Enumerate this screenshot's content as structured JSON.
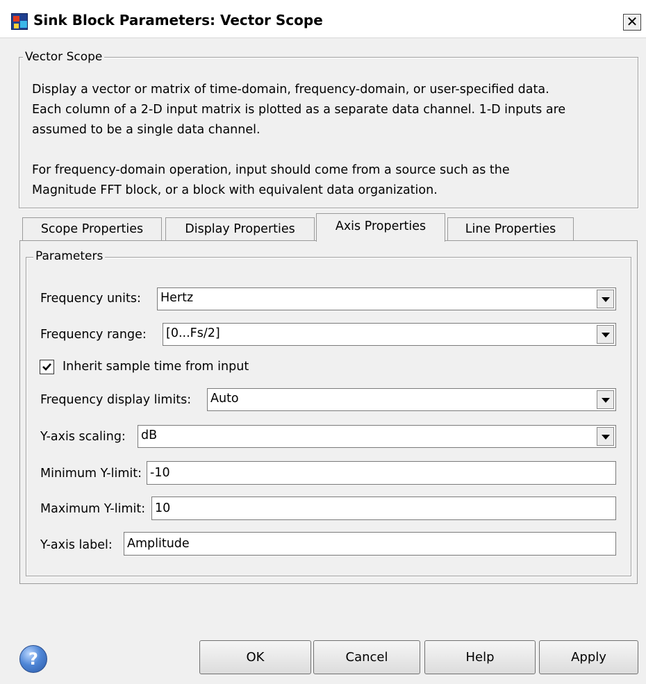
{
  "window": {
    "title": "Sink Block Parameters: Vector Scope",
    "close_glyph": "✕"
  },
  "description_group": {
    "legend": "Vector Scope",
    "lines": [
      "Display a vector or matrix of time-domain, frequency-domain, or user-specified data.",
      "Each column of a 2-D input matrix is plotted as a separate data channel.  1-D inputs are",
      "assumed to be a single data channel.",
      "",
      "For frequency-domain operation, input should come from a source such as the",
      "Magnitude FFT block, or a block with equivalent data organization."
    ]
  },
  "tabs": [
    {
      "label": "Scope Properties",
      "active": false
    },
    {
      "label": "Display Properties",
      "active": false
    },
    {
      "label": "Axis Properties",
      "active": true
    },
    {
      "label": "Line Properties",
      "active": false
    }
  ],
  "parameters": {
    "legend": "Parameters",
    "frequency_units": {
      "label": "Frequency units:",
      "value": "Hertz"
    },
    "frequency_range": {
      "label": "Frequency range:",
      "value": "[0...Fs/2]"
    },
    "inherit_sample_time": {
      "label": "Inherit sample time from input",
      "checked": true
    },
    "frequency_display_limits": {
      "label": "Frequency display limits:",
      "value": "Auto"
    },
    "y_axis_scaling": {
      "label": "Y-axis scaling:",
      "value": "dB"
    },
    "minimum_y_limit": {
      "label": "Minimum Y-limit:",
      "value": "-10"
    },
    "maximum_y_limit": {
      "label": "Maximum Y-limit:",
      "value": "10"
    },
    "y_axis_label": {
      "label": "Y-axis label:",
      "value": "Amplitude"
    }
  },
  "buttons": {
    "help_icon_glyph": "?",
    "ok": "OK",
    "cancel": "Cancel",
    "help": "Help",
    "apply": "Apply"
  },
  "icons": {
    "app": "simulink-block-icon",
    "help": "help-question-icon",
    "close": "close-icon",
    "dropdown": "chevron-down-icon"
  },
  "colors": {
    "dialog_background": "#f0f0f0",
    "titlebar_background": "#ffffff",
    "help_icon": "#4f86d6"
  }
}
